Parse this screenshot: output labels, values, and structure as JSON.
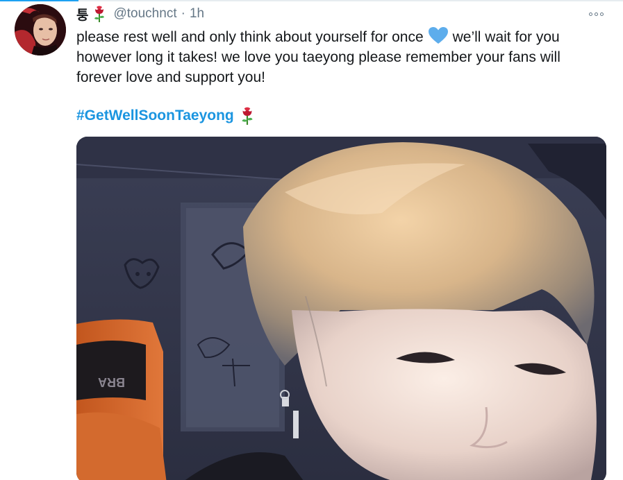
{
  "tweet": {
    "display_name": "퉁",
    "name_emoji": "rose-emoji",
    "handle": "@touchnct",
    "separator": "·",
    "time": "1h",
    "text_part1": "please rest well and only think about yourself for once",
    "text_emoji": "blue-heart-emoji",
    "text_part2": "we’ll wait for you however long it takes! we love you taeyong please remember your fans will forever love and support you!",
    "hashtag": "#GetWellSoonTaeyong",
    "hashtag_emoji": "rose-emoji",
    "media_type": "video-thumbnail",
    "chair_text": "BRA"
  },
  "colors": {
    "text": "#14171a",
    "muted": "#657786",
    "hashtag": "#1b95e0",
    "heart": "#5dadec",
    "rose": "#be1931"
  }
}
